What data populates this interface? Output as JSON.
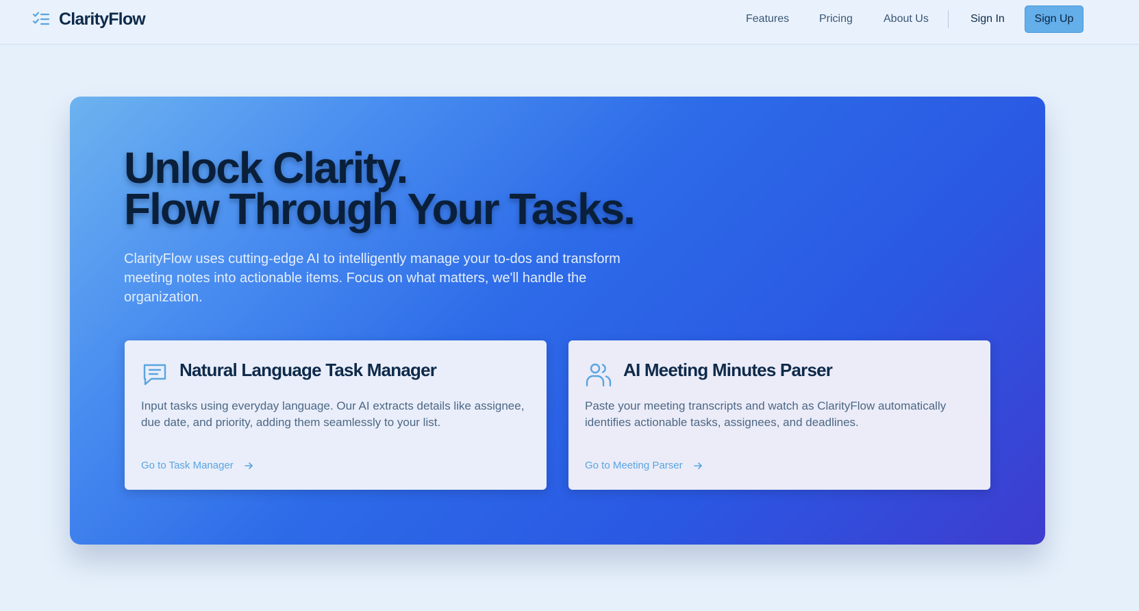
{
  "brand": {
    "name": "ClarityFlow",
    "icon": "checklist-icon"
  },
  "nav": {
    "features": "Features",
    "pricing": "Pricing",
    "about": "About Us",
    "sign_in": "Sign In",
    "sign_up": "Sign Up"
  },
  "hero": {
    "headline_line1": "Unlock Clarity.",
    "headline_line2": "Flow Through Your Tasks.",
    "subtitle": "ClarityFlow uses cutting-edge AI to intelligently manage your to-dos and transform meeting notes into actionable items. Focus on what matters, we'll handle the organization."
  },
  "cards": [
    {
      "icon": "chat-bubble-icon",
      "title": "Natural Language Task Manager",
      "description": "Input tasks using everyday language. Our AI extracts details like assignee, due date, and priority, adding them seamlessly to your list.",
      "link": "Go to Task Manager"
    },
    {
      "icon": "users-icon",
      "title": "AI Meeting Minutes Parser",
      "description": "Paste your meeting transcripts and watch as ClarityFlow automatically identifies actionable tasks, assignees, and deadlines.",
      "link": "Go to Meeting Parser"
    }
  ],
  "colors": {
    "accent": "#64aee9",
    "link": "#5aa4df",
    "hero_gradient_start": "#6db3ef",
    "hero_gradient_mid": "#2a58e3",
    "hero_gradient_end": "#3e3ccf",
    "page_bg": "#e6f0fb"
  }
}
